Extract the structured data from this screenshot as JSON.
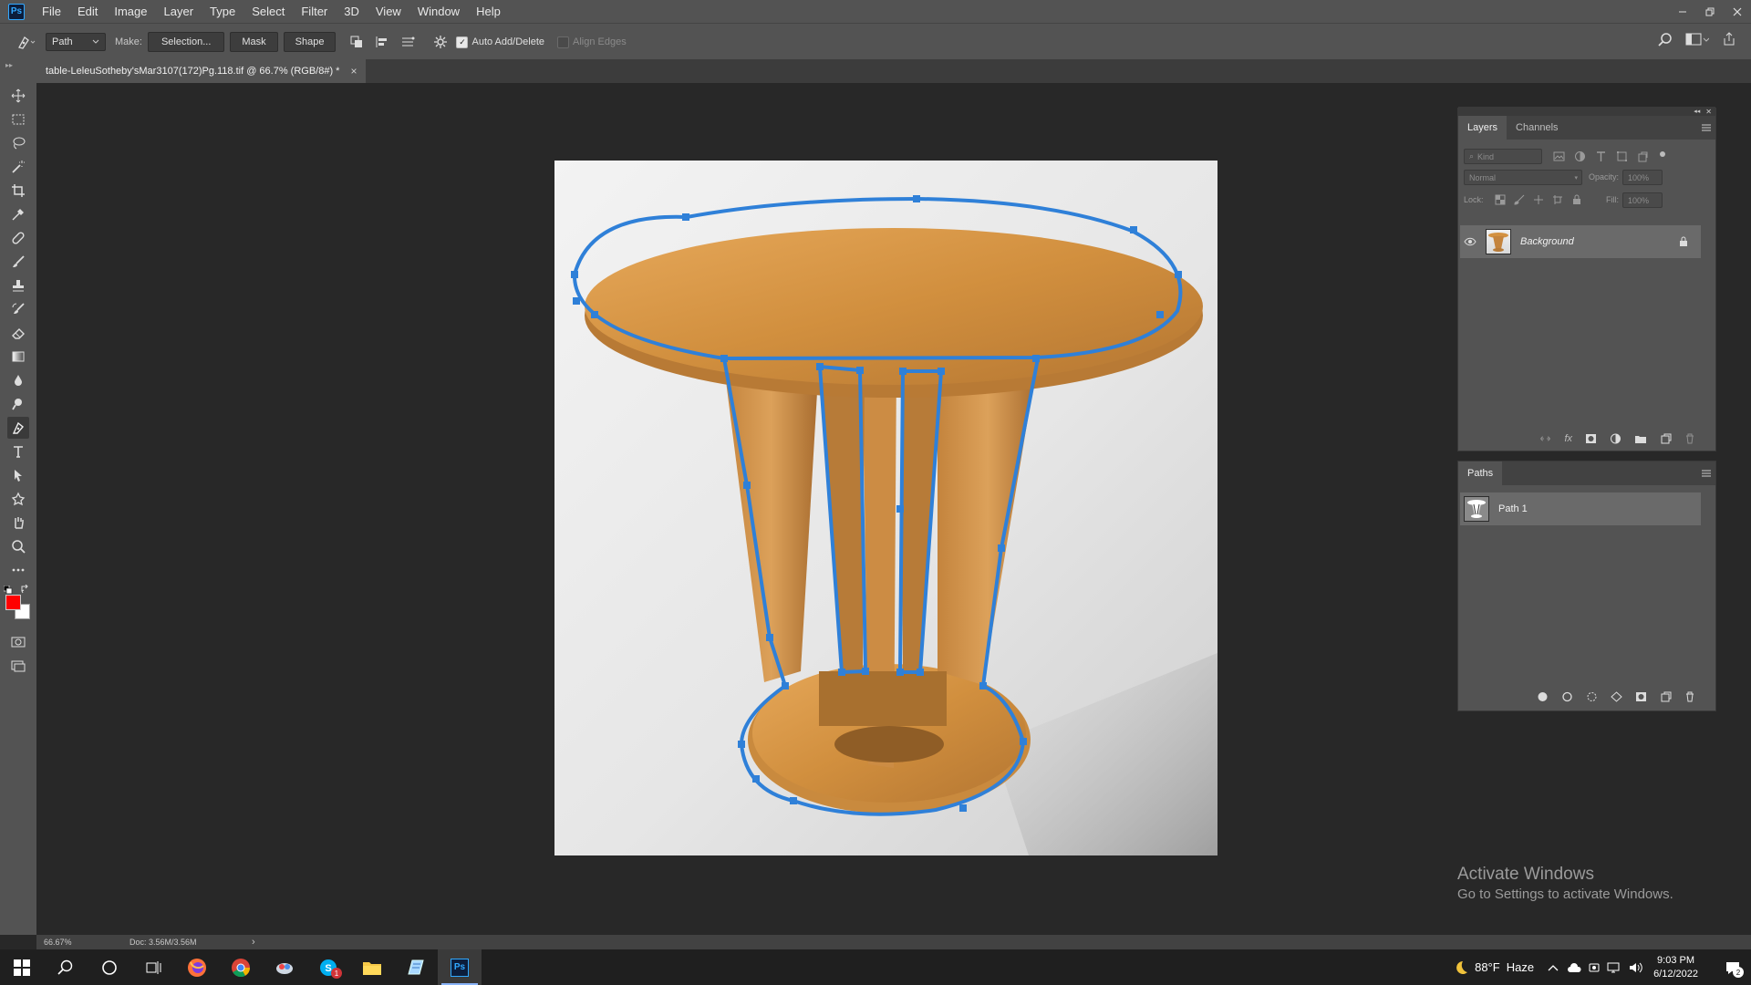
{
  "app": {
    "logo": "Ps",
    "menu": [
      "File",
      "Edit",
      "Image",
      "Layer",
      "Type",
      "Select",
      "Filter",
      "3D",
      "View",
      "Window",
      "Help"
    ]
  },
  "options_bar": {
    "tool_mode": "Path",
    "make_label": "Make:",
    "selection_button": "Selection...",
    "mask_button": "Mask",
    "shape_button": "Shape",
    "auto_add_delete": {
      "label": "Auto Add/Delete",
      "checked": true
    },
    "align_edges": {
      "label": "Align Edges",
      "checked": false
    }
  },
  "document": {
    "tab_title": "table-LeleuSotheby'sMar3107(172)Pg.118.tif @ 66.7% (RGB/8#) *",
    "close_glyph": "×"
  },
  "status_bar": {
    "zoom": "66.67%",
    "doc_info": "Doc: 3.56M/3.56M",
    "arrow": "›"
  },
  "layers_panel": {
    "tabs": [
      "Layers",
      "Channels"
    ],
    "active_tab": "Layers",
    "filter_placeholder": "Kind",
    "blend_mode": "Normal",
    "opacity_label": "Opacity:",
    "opacity_value": "100%",
    "lock_label": "Lock:",
    "fill_label": "Fill:",
    "fill_value": "100%",
    "layers": [
      {
        "name": "Background",
        "visible": true,
        "locked": true
      }
    ]
  },
  "paths_panel": {
    "title": "Paths",
    "paths": [
      {
        "name": "Path 1",
        "selected": true
      }
    ]
  },
  "watermark": {
    "title": "Activate Windows",
    "subtitle": "Go to Settings to activate Windows."
  },
  "taskbar": {
    "weather_temp": "88°F",
    "weather_desc": "Haze",
    "time": "9:03 PM",
    "date": "6/12/2022",
    "notification_count": "2",
    "skype_badge": "1"
  },
  "colors": {
    "foreground": "#ff0000",
    "background": "#ffffff",
    "path_stroke": "#2f80d8",
    "accent": "#31a8ff"
  }
}
